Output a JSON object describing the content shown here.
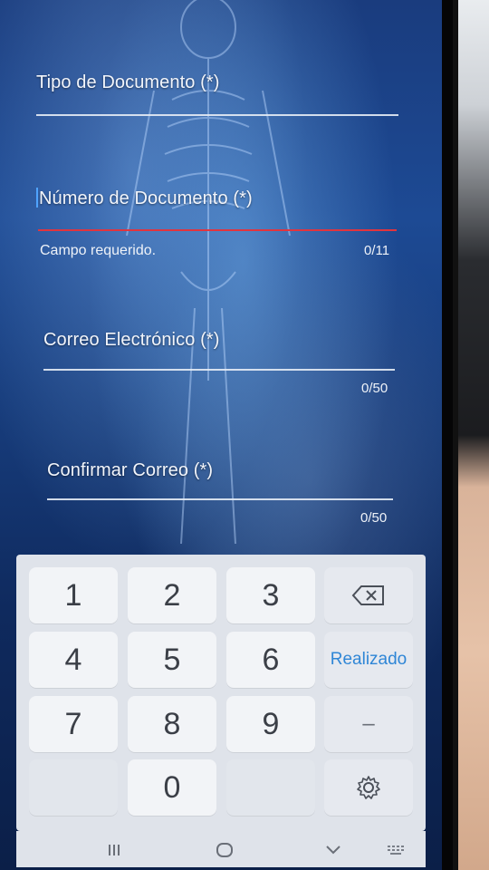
{
  "form": {
    "fields": [
      {
        "label": "Tipo de Documento (*)"
      },
      {
        "label": "Número de Documento (*)",
        "helper": "Campo requerido.",
        "counter": "0/11"
      },
      {
        "label": "Correo Electrónico (*)",
        "counter": "0/50"
      },
      {
        "label": "Confirmar Correo (*)",
        "counter": "0/50"
      }
    ]
  },
  "keyboard": {
    "keys": [
      "1",
      "2",
      "3",
      "4",
      "5",
      "6",
      "7",
      "8",
      "9",
      "0"
    ],
    "done_label": "Realizado",
    "dash_label": "–"
  },
  "colors": {
    "error": "#e2343e",
    "accent": "#2f86d6"
  }
}
